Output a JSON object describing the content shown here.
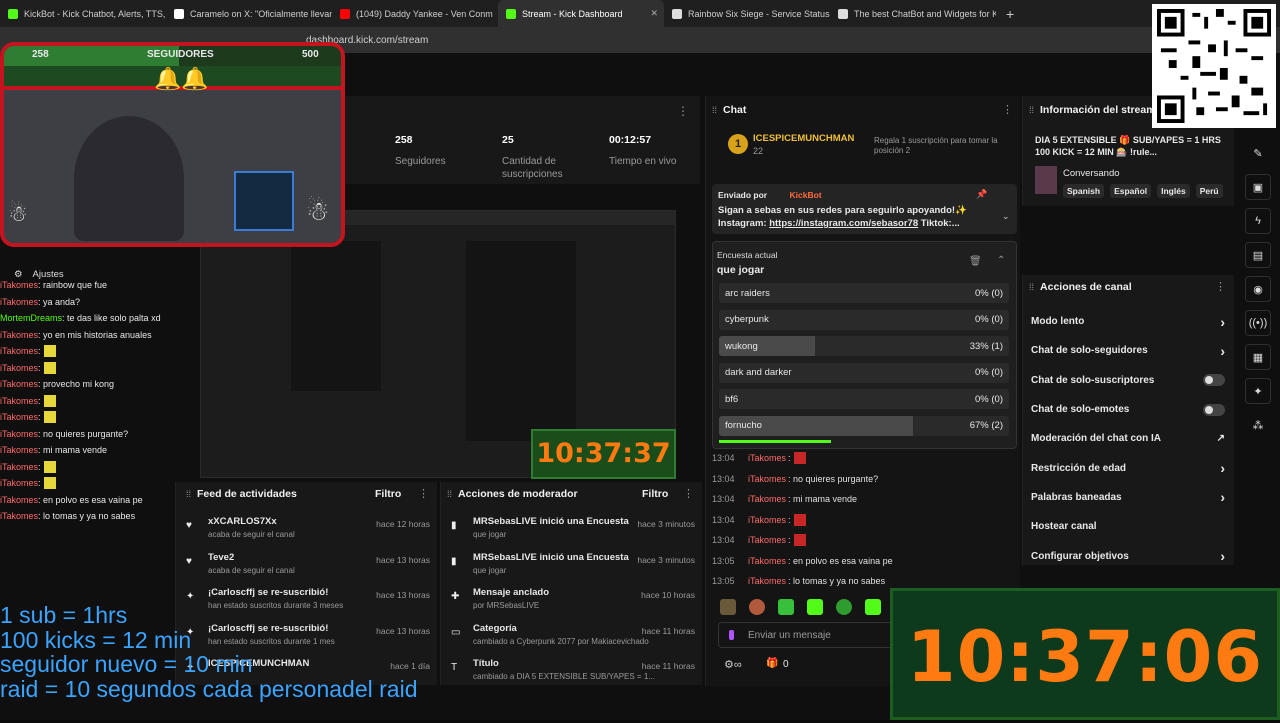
{
  "browser": {
    "tabs": [
      {
        "title": "KickBot - Kick Chatbot, Alerts, TTS, O",
        "color": "#53fc18"
      },
      {
        "title": "Caramelo on X: \"Oficialmente llevam",
        "color": "#ffffff"
      },
      {
        "title": "(1049) Daddy Yankee - Ven Conm",
        "color": "#ff0000"
      },
      {
        "title": "Stream - Kick Dashboard",
        "color": "#53fc18",
        "active": true
      },
      {
        "title": "Rainbow Six Siege - Service Status | U",
        "color": "#dddddd"
      },
      {
        "title": "The best ChatBot and Widgets for Ki",
        "color": "#dddddd"
      }
    ],
    "new_tab": "+",
    "url": "dashboard.kick.com/stream"
  },
  "overlay": {
    "followers_current": "258",
    "followers_label": "SEGUIDORES",
    "followers_goal": "500",
    "settings_label": "Ajustes",
    "left_chat": [
      {
        "user": "iTakomes",
        "text": ": rainbow que fue"
      },
      {
        "user": "iTakomes",
        "text": ": ya anda?"
      },
      {
        "user": "MortemDreams",
        "text": ": te das like solo palta xd",
        "color": "#53fc18"
      },
      {
        "user": "iTakomes",
        "text": ": yo en mis historias anuales"
      },
      {
        "user": "iTakomes",
        "text": ":",
        "emoji": "y"
      },
      {
        "user": "iTakomes",
        "text": ":",
        "emoji": "y"
      },
      {
        "user": "iTakomes",
        "text": ": provecho mi kong"
      },
      {
        "user": "iTakomes",
        "text": ":",
        "emoji": "y"
      },
      {
        "user": "iTakomes",
        "text": ":",
        "emoji": "y"
      },
      {
        "user": "iTakomes",
        "text": ": no quieres purgante?"
      },
      {
        "user": "iTakomes",
        "text": ": mi mama vende"
      },
      {
        "user": "iTakomes",
        "text": ":",
        "emoji": "y"
      },
      {
        "user": "iTakomes",
        "text": ":",
        "emoji": "y"
      },
      {
        "user": "iTakomes",
        "text": ": en polvo es esa vaina pe"
      },
      {
        "user": "iTakomes",
        "text": ": lo tomas y ya no sabes"
      }
    ],
    "rules": [
      "1 sub = 1hrs",
      "100 kicks = 12 min",
      "seguidor nuevo = 10 min",
      "raid = 10 segundos cada personadel raid"
    ],
    "timer": "10:37:06",
    "preview_timer": "10:37:37"
  },
  "stats": [
    {
      "value": "258",
      "label": "Seguidores"
    },
    {
      "value": "25",
      "label": "Cantidad de suscripciones"
    },
    {
      "value": "00:12:57",
      "label": "Tiempo en vivo"
    }
  ],
  "chat": {
    "title": "Chat",
    "top_gifter": {
      "name": "ICESPICEMUNCHMAN",
      "count": "22",
      "rank": "1",
      "note": "Regala 1 suscripción para tomar la posición 2"
    },
    "pinned": {
      "label": "Enviado por",
      "by": "KickBot",
      "text": "Sigan a sebas en sus redes para seguirlo apoyando!✨ Instagram: ",
      "link": "https://instagram.com/sebasor78",
      "tail": " Tiktok:..."
    },
    "poll": {
      "label": "Encuesta actual",
      "question": "que jogar",
      "options": [
        {
          "name": "arc raiders",
          "result": "0% (0)",
          "pct": 0
        },
        {
          "name": "cyberpunk",
          "result": "0% (0)",
          "pct": 0
        },
        {
          "name": "wukong",
          "result": "33% (1)",
          "pct": 33
        },
        {
          "name": "dark and darker",
          "result": "0% (0)",
          "pct": 0
        },
        {
          "name": "bf6",
          "result": "0% (0)",
          "pct": 0
        },
        {
          "name": "fornucho",
          "result": "67% (2)",
          "pct": 67
        }
      ]
    },
    "messages": [
      {
        "time": "13:04",
        "user": "iTakomes",
        "text": ":",
        "emoji": true
      },
      {
        "time": "13:04",
        "user": "iTakomes",
        "text": ": no quieres purgante?"
      },
      {
        "time": "13:04",
        "user": "iTakomes",
        "text": ": mi mama vende"
      },
      {
        "time": "13:04",
        "user": "iTakomes",
        "text": ":",
        "emoji": true
      },
      {
        "time": "13:04",
        "user": "iTakomes",
        "text": ":",
        "emoji": true
      },
      {
        "time": "13:05",
        "user": "iTakomes",
        "text": ": en polvo es esa vaina pe"
      },
      {
        "time": "13:05",
        "user": "iTakomes",
        "text": ": lo tomas y ya no sabes"
      }
    ],
    "input_placeholder": "Enviar un mensaje",
    "points": "0"
  },
  "stream_info": {
    "title": "Información del stream",
    "stream_title": "DIA 5 EXTENSIBLE 🎁 SUB/YAPES = 1 HRS 100 KICK = 12 MIN 🎰 !rule...",
    "category": "Conversando",
    "tags": [
      "Spanish",
      "Español",
      "Inglés",
      "Perú"
    ]
  },
  "channel_actions": {
    "title": "Acciones de canal",
    "items": [
      {
        "label": "Modo lento",
        "type": "chevron"
      },
      {
        "label": "Chat de solo-seguidores",
        "type": "chevron"
      },
      {
        "label": "Chat de solo-suscriptores",
        "type": "toggle"
      },
      {
        "label": "Chat de solo-emotes",
        "type": "toggle"
      },
      {
        "label": "Moderación del chat con IA",
        "type": "external"
      },
      {
        "label": "Restricción de edad",
        "type": "chevron"
      },
      {
        "label": "Palabras baneadas",
        "type": "chevron"
      },
      {
        "label": "Hostear canal",
        "type": "none"
      },
      {
        "label": "Configurar objetivos",
        "type": "chevron"
      }
    ]
  },
  "activity_feed": {
    "title": "Feed de actividades",
    "filter": "Filtro",
    "items": [
      {
        "icon": "heart-icon",
        "title": "xXCARLOS7Xx",
        "sub": "acaba de seguir el canal",
        "time": "hace 12 horas"
      },
      {
        "icon": "heart-icon",
        "title": "Teve2",
        "sub": "acaba de seguir el canal",
        "time": "hace 13 horas"
      },
      {
        "icon": "star-icon",
        "title": "¡Carloscffj se re-suscribió!",
        "sub": "han estado suscritos durante 3 meses",
        "time": "hace 13 horas"
      },
      {
        "icon": "star-icon",
        "title": "¡Carloscffj se re-suscribió!",
        "sub": "han estado suscritos durante 1 mes",
        "time": "hace 13 horas"
      },
      {
        "icon": "star-icon",
        "title": "ICESPICEMUNCHMAN",
        "sub": "",
        "time": "hace 1 día"
      }
    ]
  },
  "mod_actions": {
    "title": "Acciones de moderador",
    "filter": "Filtro",
    "items": [
      {
        "icon": "poll-icon",
        "title": "MRSebasLIVE inició una Encuesta",
        "sub": "que jogar",
        "time": "hace 3 minutos"
      },
      {
        "icon": "poll-icon",
        "title": "MRSebasLIVE inició una Encuesta",
        "sub": "que jogar",
        "time": "hace 3 minutos"
      },
      {
        "icon": "pin-icon",
        "title": "Mensaje anclado",
        "sub": "por MRSebasLIVE",
        "time": "hace 10 horas"
      },
      {
        "icon": "category-icon",
        "title": "Categoría",
        "sub": "cambiado a Cyberpunk 2077 por Makiacevichado",
        "time": "hace 11 horas"
      },
      {
        "icon": "title-icon",
        "title": "Título",
        "sub": "cambiado a DIA 5 EXTENSIBLE SUB/YAPES = 1...",
        "time": "hace 11 horas"
      }
    ]
  }
}
